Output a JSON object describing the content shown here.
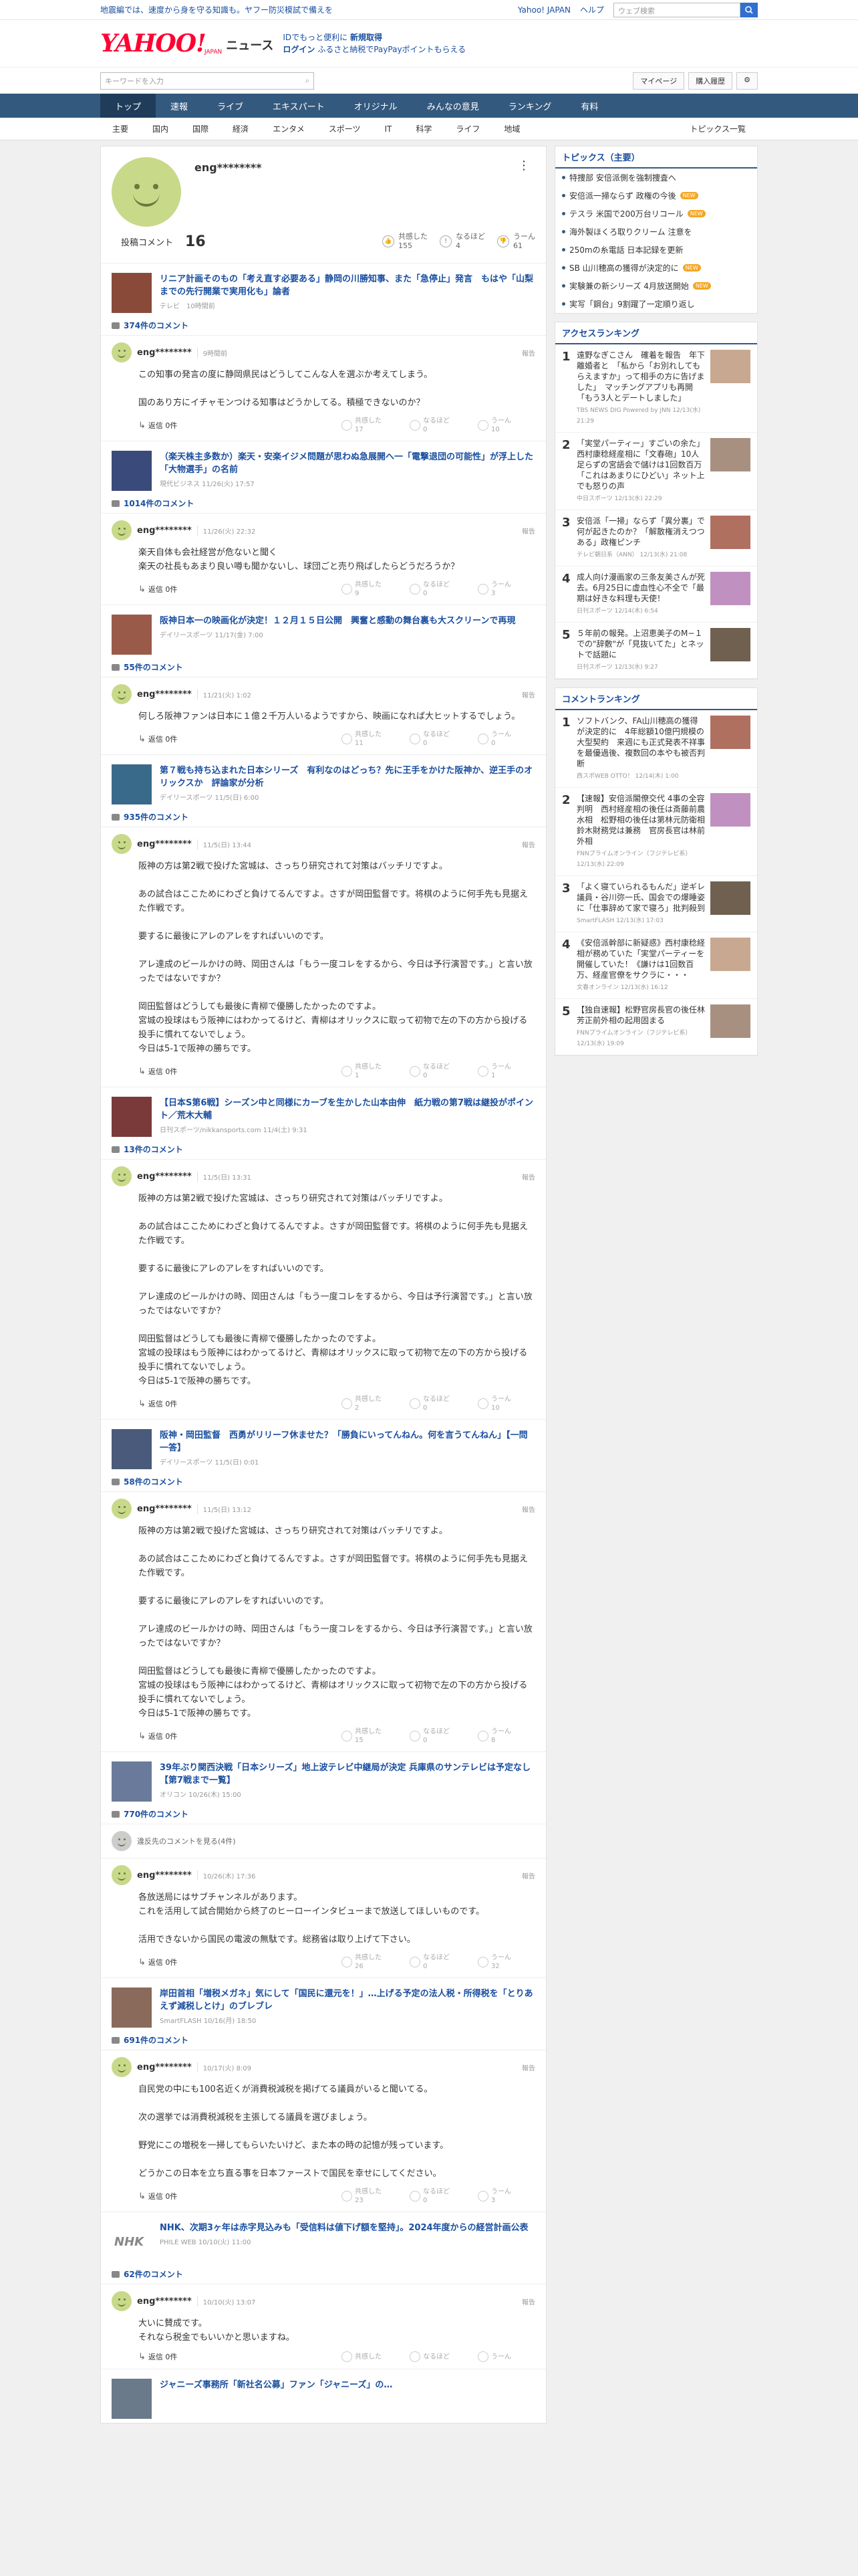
{
  "topbar": {
    "notice": "地震編では、速度から身を守る知識も。ヤフー防災模試で備えを",
    "links": [
      "Yahoo! JAPAN",
      "ヘルプ"
    ],
    "search_placeholder": "ウェブ検索"
  },
  "header": {
    "logo_yahoo": "YAHOO!",
    "logo_japan": "JAPAN",
    "logo_news": "ニュース",
    "promo1_a": "IDでもっと便利に",
    "promo1_b": "新規取得",
    "promo2_a": "ログイン",
    "promo2_b": "ふるさと納税でPayPayポイントもらえる"
  },
  "searchrow": {
    "placeholder": "キーワードを入力",
    "mypage": "マイページ",
    "settings": "購入履歴"
  },
  "nav": [
    "トップ",
    "速報",
    "ライブ",
    "エキスパート",
    "オリジナル",
    "みんなの意見",
    "ランキング",
    "有料"
  ],
  "subnav": [
    "主要",
    "国内",
    "国際",
    "経済",
    "エンタメ",
    "スポーツ",
    "IT",
    "科学",
    "ライフ",
    "地域"
  ],
  "subnav_more": "トピックス一覧",
  "profile": {
    "name": "eng********",
    "stat_label": "投稿コメント",
    "stat_count": "16",
    "votes": [
      {
        "label": "共感した",
        "count": "155"
      },
      {
        "label": "なるほど",
        "count": "4"
      },
      {
        "label": "うーん",
        "count": "61"
      }
    ]
  },
  "threads": [
    {
      "title": "リニア計画そのもの「考え直す必要ある」静岡の川勝知事、また「急停止」発言　もはや「山梨までの先行開業で実用化も」論者",
      "source": "テレビ　10時間前",
      "count": "374件のコメント",
      "user": "eng********",
      "date": "9時間前",
      "body": "この知事の発言の度に静岡県民はどうしてこんな人を選ぶか考えてしまう。\n\n国のあり方にイチャモンつける知事はどうかしてる。積極できないのか？",
      "v": [
        "17",
        "0",
        "10"
      ]
    },
    {
      "title": "（楽天株主多数か）楽天・安楽イジメ問題が思わぬ急展開へ一「電撃退団の可能性」が浮上した「大物選手」の名前",
      "source": "現代ビジネス 11/26(火) 17:57",
      "count": "1014件のコメント",
      "user": "eng********",
      "date": "11/26(火) 22:32",
      "body": "楽天自体も会社経営が危ないと聞く\n楽天の社長もあまり良い噂も聞かないし、球団ごと売り飛ばしたらどうだろうか？",
      "v": [
        "9",
        "0",
        "3"
      ]
    },
    {
      "title": "阪神日本一の映画化が決定！１２月１５日公開　興奮と感動の舞台裏も大スクリーンで再現",
      "source": "デイリースポーツ 11/17(金) 7:00",
      "count": "55件のコメント",
      "user": "eng********",
      "date": "11/21(火) 1:02",
      "body": "何しろ阪神ファンは日本に１億２千万人いるようですから、映画になれば大ヒットするでしょう。",
      "v": [
        "11",
        "0",
        "0"
      ]
    },
    {
      "title": "第７戦も持ち込まれた日本シリーズ　有利なのはどっち？先に王手をかけた阪神か、逆王手のオリックスか　評論家が分析",
      "source": "デイリースポーツ 11/5(日) 6:00",
      "count": "935件のコメント",
      "user": "eng********",
      "date": "11/5(日) 13:44",
      "body": "阪神の方は第2戦で投げた宮城は、さっちり研究されて対策はバッチリですよ。\n\nあの試合はここためにわざと負けてるんですよ。さすが岡田監督です。将棋のように何手先も見据えた作戦です。\n\n要するに最後にアレのアレをすればいいのです。\n\nアレ達成のビールかけの時、岡田さんは「もう一度コレをするから、今日は予行演習です。」と言い放ったではないですか？\n\n岡田監督はどうしても最後に青柳で優勝したかったのですよ。\n宮城の投球はもう阪神にはわかってるけど、青柳はオリックスに取って初物で左の下の方から投げる投手に慣れてないでしょう。\n今日は5-1で阪神の勝ちです。",
      "v": [
        "1",
        "0",
        "1"
      ]
    },
    {
      "title": "【日本S第6戦】シーズン中と同様にカーブを生かした山本由伸　紙力戦の第7戦は継投がポイント／荒木大輔",
      "source": "日刊スポーツ/nikkansports.com 11/4(土) 9:31",
      "count": "13件のコメント",
      "user": "eng********",
      "date": "11/5(日) 13:31",
      "body": "阪神の方は第2戦で投げた宮城は、さっちり研究されて対策はバッチリですよ。\n\nあの試合はここためにわざと負けてるんですよ。さすが岡田監督です。将棋のように何手先も見据えた作戦です。\n\n要するに最後にアレのアレをすればいいのです。\n\nアレ達成のビールかけの時、岡田さんは「もう一度コレをするから、今日は予行演習です。」と言い放ったではないですか？\n\n岡田監督はどうしても最後に青柳で優勝したかったのですよ。\n宮城の投球はもう阪神にはわかってるけど、青柳はオリックスに取って初物で左の下の方から投げる投手に慣れてないでしょう。\n今日は5-1で阪神の勝ちです。",
      "v": [
        "2",
        "0",
        "10"
      ]
    },
    {
      "title": "阪神・岡田監督　西勇がリリーフ休ませた？「勝負にいってんねん。何を言うてんねん」【一問一答】",
      "source": "デイリースポーツ 11/5(日) 0:01",
      "count": "58件のコメント",
      "user": "eng********",
      "date": "11/5(日) 13:12",
      "body": "阪神の方は第2戦で投げた宮城は、さっちり研究されて対策はバッチリですよ。\n\nあの試合はここためにわざと負けてるんですよ。さすが岡田監督です。将棋のように何手先も見据えた作戦です。\n\n要するに最後にアレのアレをすればいいのです。\n\nアレ達成のビールかけの時、岡田さんは「もう一度コレをするから、今日は予行演習です。」と言い放ったではないですか？\n\n岡田監督はどうしても最後に青柳で優勝したかったのですよ。\n宮城の投球はもう阪神にはわかってるけど、青柳はオリックスに取って初物で左の下の方から投げる投手に慣れてないでしょう。\n今日は5-1で阪神の勝ちです。",
      "v": [
        "15",
        "0",
        "8"
      ]
    },
    {
      "title": "39年ぶり関西決戦「日本シリーズ」地上波テレビ中継局が決定 兵庫県のサンテレビは予定なし【第7戦まで一覧】",
      "source": "オリコン 10/26(木) 15:00",
      "count": "770件のコメント",
      "hidden": "違反先のコメントを見る(4件)",
      "user": "eng********",
      "date": "10/26(木) 17:36",
      "body": "各放送局にはサブチャンネルがあります。\nこれを活用して試合開始から終了のヒーローインタビューまで放送してほしいものです。\n\n活用できないから国民の電波の無駄です。総務省は取り上げて下さい。",
      "v": [
        "26",
        "0",
        "32"
      ]
    },
    {
      "title": "岸田首相「増税メガネ」気にして「国民に還元を！」…上げる予定の法人税・所得税を「とりあえず減税しとけ」のブレブレ",
      "source": "SmartFLASH 10/16(月) 18:50",
      "count": "691件のコメント",
      "user": "eng********",
      "date": "10/17(火) 8:09",
      "body": "自民党の中にも100名近くが消費税減税を掲げてる議員がいると聞いてる。\n\n次の選挙では消費税減税を主張してる議員を選びましょう。\n\n野党にこの増税を一掃してもらいたいけど、また本の時の記憶が残っています。\n\nどうかこの日本を立ち直る事を日本ファーストで国民を幸せにしてください。",
      "v": [
        "23",
        "0",
        "3"
      ]
    },
    {
      "title": "NHK、次期3ヶ年は赤字見込みも「受信料は値下げ額を堅持」。2024年度からの経営計画公表",
      "source": "PHILE WEB 10/10(火) 11:00",
      "count": "62件のコメント",
      "user": "eng********",
      "date": "10/10(火) 13:07",
      "body": "大いに賛成です。\nそれなら税金でもいいかと思いますね。",
      "v": [
        "",
        "",
        ""
      ]
    }
  ],
  "thread_last_title": "ジャニーズ事務所「新社名公募」ファン「ジャニーズ」の…",
  "vote_labels": [
    "共感した",
    "なるほど",
    "うーん"
  ],
  "reply_label": "返信 0件",
  "report_label": "報告",
  "side": {
    "topics_title": "トピックス（主要）",
    "topics": [
      {
        "t": "特捜部 安倍派側を強制捜査へ",
        "n": false
      },
      {
        "t": "安倍派一掃ならず 政権の今後",
        "n": true
      },
      {
        "t": "テスラ 米国で200万台リコール",
        "n": true
      },
      {
        "t": "海外製ほくろ取りクリーム 注意を",
        "n": false
      },
      {
        "t": "250mの糸電話 日本記録を更新",
        "n": false
      },
      {
        "t": "SB 山川穂高の獲得が決定的に",
        "n": true
      },
      {
        "t": "実験兼の新シリーズ 4月放送開始",
        "n": true
      },
      {
        "t": "実写「鋼台」9割躍了一定順り返し",
        "n": false
      }
    ],
    "new_label": "NEW",
    "access_title": "アクセスランキング",
    "access": [
      {
        "t": "遠野なぎこさん　確着を報告　年下離婚者と　「私から「お別れしてもらえますか」って相手の方に告げました」　マッチングアプリも再開　「もう3人とデートしました」",
        "s": "TBS NEWS DIG Powered by JNN 12/13(水) 21:29"
      },
      {
        "t": "「実堂パーティー」すごいの余た」西村康稔経産相に「文春砲」10人足らずの宮語会で儲けは1回数百万「これはあまりにひどい」ネット上でも怒りの声",
        "s": "中日スポーツ 12/13(水) 22:29"
      },
      {
        "t": "安倍派「一掃」ならず「異分裏」で何が起きたのか？「解散権消えつつある」政権ピンチ",
        "s": "テレビ朝日系（ANN） 12/13(水) 21:08"
      },
      {
        "t": "成人向け漫画家の三条友美さんが死去。6月25日に虚血性心不全で「最期は好きな料理も天使！",
        "s": "日刊スポーツ 12/14(木) 6:54"
      },
      {
        "t": "５年前の報発。上沼恵美子のM−１での\"辞敷\"が「見抜いてた」とネットで話題に",
        "s": "日刊スポーツ 12/13(水) 9:27"
      }
    ],
    "comment_title": "コメントランキング",
    "comments": [
      {
        "t": "ソフトバンク、FA山川穂高の獲得が決定的に　4年総額10億円規模の大型契約　来週にも正式発表不祥事を最優過後、複数回の本やも被否判断",
        "s": "西スポWEB OTTO！ 12/14(木) 1:00"
      },
      {
        "t": "【速報】安倍派閣僚交代 4事の全容判明　西村経産相の後任は斎藤前農水相　松野相の後任は第林元防衛相　鈴木財務党は兼務　官房長官は林前外相",
        "s": "FNNプライムオンライン（フジテレビ系） 12/13(水) 22:09"
      },
      {
        "t": "「よく寝ていられるもんだ」逆ギレ議員・谷川弥一氏、国会での爆睡姿に「仕事辞めて家で寝ろ」批判殺到",
        "s": "SmartFLASH 12/13(水) 17:03"
      },
      {
        "t": "《安倍派幹部に新疑惑》西村康稔経相が務めていた「実堂パーティーを開催していた！《謙けは1回数百万、経産官僚をサクラに・・・",
        "s": "文春オンライン 12/13(水) 16:12"
      },
      {
        "t": "【独自速報】松野官房長官の後任林芳正前外相の起用固まる",
        "s": "FNNプライムオンライン（フジテレビ系） 12/13(水) 19:09"
      }
    ]
  }
}
